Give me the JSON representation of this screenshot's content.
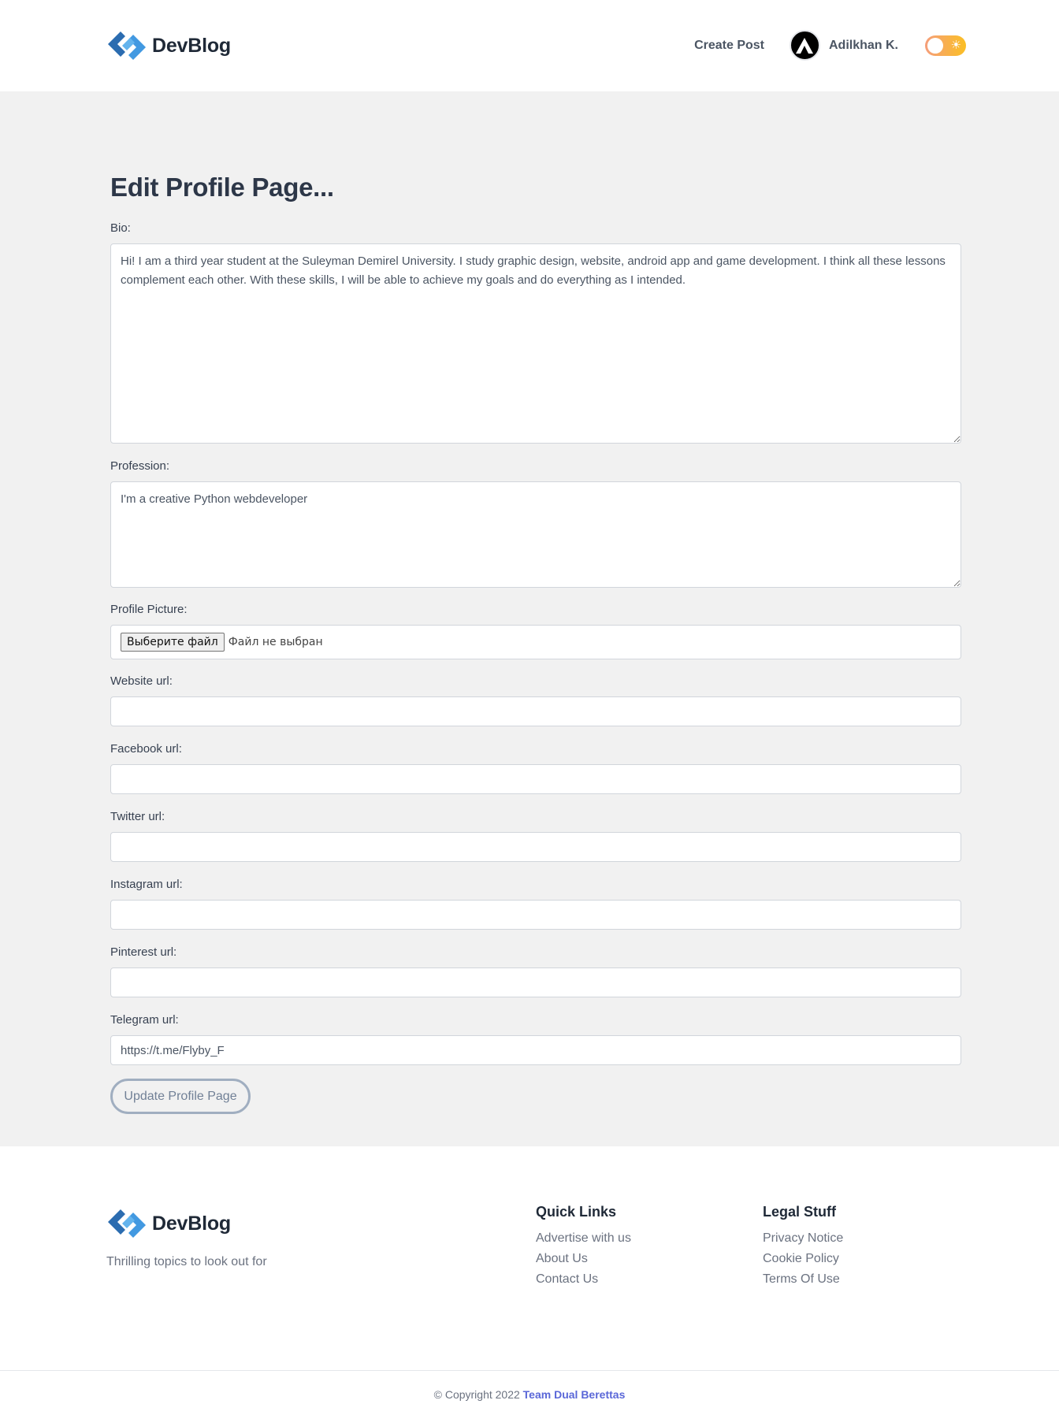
{
  "header": {
    "brand": "DevBlog",
    "nav": {
      "create_post": "Create Post",
      "user_name": "Adilkhan K."
    }
  },
  "main": {
    "title": "Edit Profile Page...",
    "fields": {
      "bio": {
        "label": "Bio:",
        "value": "Hi! I am a third year student at the Suleyman Demirel University. I study graphic design, website, android app and game development. I think all these lessons complement each other. With these skills, I will be able to achieve my goals and do everything as I intended."
      },
      "profession": {
        "label": "Profession:",
        "value": "I'm a creative Python webdeveloper"
      },
      "profile_picture": {
        "label": "Profile Picture:",
        "button": "Выберите файл",
        "status": "Файл не выбран"
      },
      "website": {
        "label": "Website url:",
        "value": ""
      },
      "facebook": {
        "label": "Facebook url:",
        "value": ""
      },
      "twitter": {
        "label": "Twitter url:",
        "value": ""
      },
      "instagram": {
        "label": "Instagram url:",
        "value": ""
      },
      "pinterest": {
        "label": "Pinterest url:",
        "value": ""
      },
      "telegram": {
        "label": "Telegram url:",
        "value": "https://t.me/Flyby_F"
      }
    },
    "submit": "Update Profile Page"
  },
  "footer": {
    "brand": "DevBlog",
    "tagline": "Thrilling topics to look out for",
    "quick_links": {
      "title": "Quick Links",
      "items": [
        "Advertise with us",
        "About Us",
        "Contact Us"
      ]
    },
    "legal": {
      "title": "Legal Stuff",
      "items": [
        "Privacy Notice",
        "Cookie Policy",
        "Terms Of Use"
      ]
    },
    "copyright_prefix": "© Copyright 2022 ",
    "copyright_team": "Team Dual Berettas"
  },
  "colors": {
    "accent": "#5a67d8",
    "page_bg": "#f1f1f1",
    "logo_blue": "#2b6cb0",
    "toggle": "#fbbf24"
  }
}
